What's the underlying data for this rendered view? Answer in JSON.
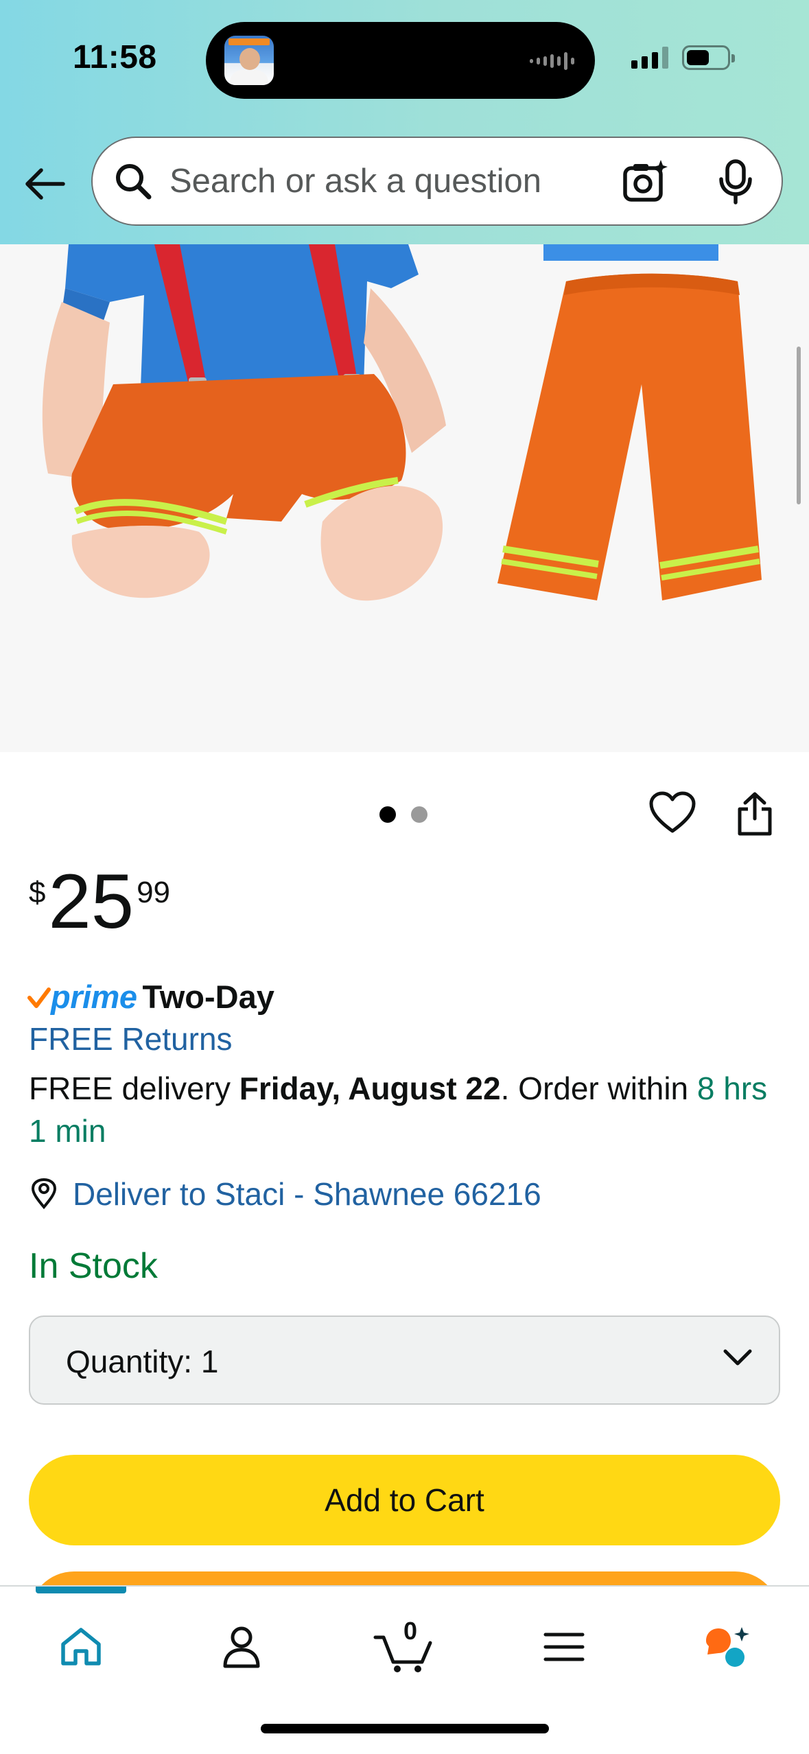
{
  "status_bar": {
    "time": "11:58"
  },
  "header": {
    "back_icon": "arrow-left-icon",
    "search": {
      "placeholder": "Search or ask a question"
    },
    "camera_icon": "camera-sparkle-icon",
    "mic_icon": "microphone-icon"
  },
  "gallery": {
    "page_count": 2,
    "active_page": 1
  },
  "product": {
    "price": {
      "symbol": "$",
      "whole": "25",
      "fraction": "99"
    },
    "prime": {
      "logo_text": "prime",
      "label": "Two-Day"
    },
    "free_returns": "FREE Returns",
    "delivery": {
      "prefix": "FREE delivery ",
      "date": "Friday, August 22",
      "middle": ". Order within ",
      "countdown": "8 hrs 1 min"
    },
    "deliver_to": "Deliver to Staci - Shawnee 66216",
    "stock": "In Stock",
    "quantity_label": "Quantity:",
    "quantity_value": "1",
    "add_to_cart": "Add to Cart"
  },
  "bottom_nav": {
    "items": [
      "home-icon",
      "account-icon",
      "cart-icon",
      "menu-icon",
      "rufus-assistant-icon"
    ],
    "cart_count": "0",
    "active": "home"
  },
  "colors": {
    "accent_blue": "#2162a1",
    "green": "#067d62",
    "stock_green": "#007a37",
    "add_to_cart": "#ffd814",
    "buy_now": "#ffa41c",
    "prime_blue": "#1b8eea",
    "nav_active": "#0f8bb0"
  }
}
